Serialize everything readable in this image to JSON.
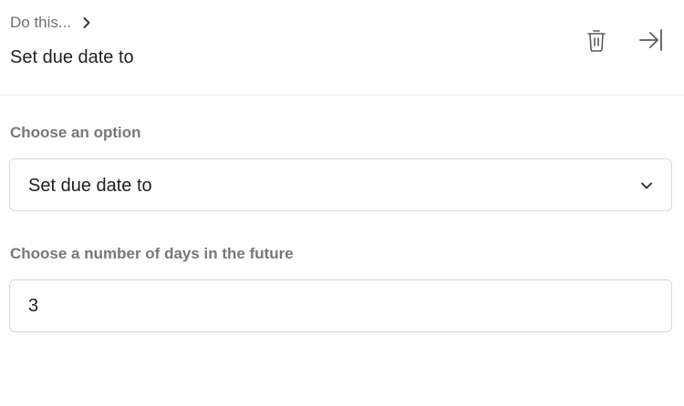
{
  "header": {
    "breadcrumb": "Do this...",
    "title": "Set due date to"
  },
  "icons": {
    "breadcrumb_chevron": "chevron-right-icon",
    "delete": "trash-icon",
    "collapse": "arrow-right-to-line-icon",
    "select_chevron": "chevron-down-icon"
  },
  "option": {
    "label": "Choose an option",
    "selected": "Set due date to"
  },
  "days": {
    "label": "Choose a number of days in the future",
    "value": "3"
  }
}
